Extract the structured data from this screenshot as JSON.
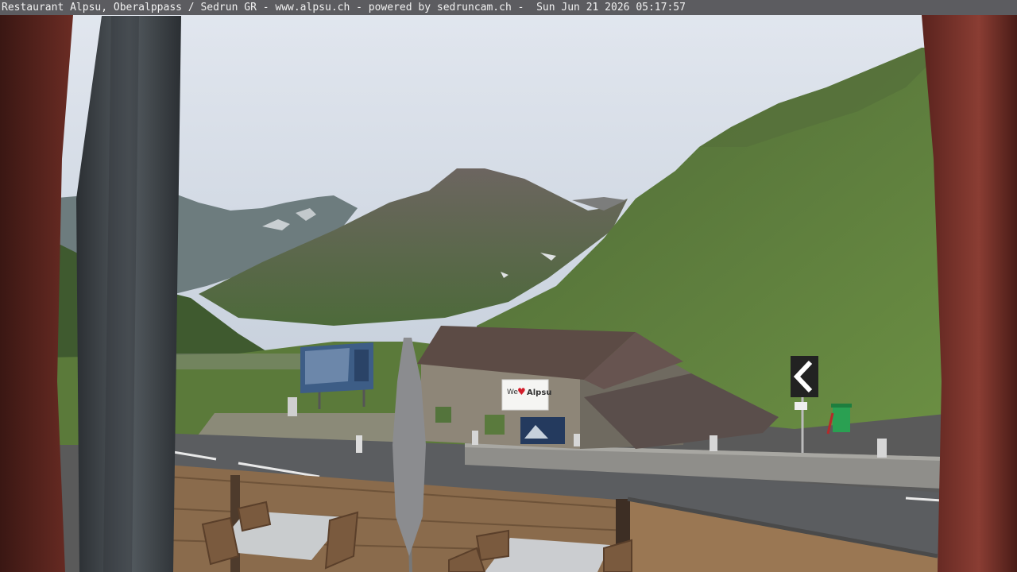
{
  "caption": {
    "text": "Restaurant Alpsu, Oberalppass / Sedrun GR - www.alpsu.ch - powered by sedruncam.ch -  Sun Jun 21 2026 05:17:57"
  },
  "scene": {
    "building_sign": "Alpsu",
    "sign_heart_color": "#d21c2a",
    "sky_color": "#d3dbe5",
    "grass_color": "#5d7f3c",
    "wood_frame_color": "#6e2a24"
  },
  "icons": {
    "road_sign": "chevron-left-icon",
    "bin": "trash-bin-icon"
  }
}
